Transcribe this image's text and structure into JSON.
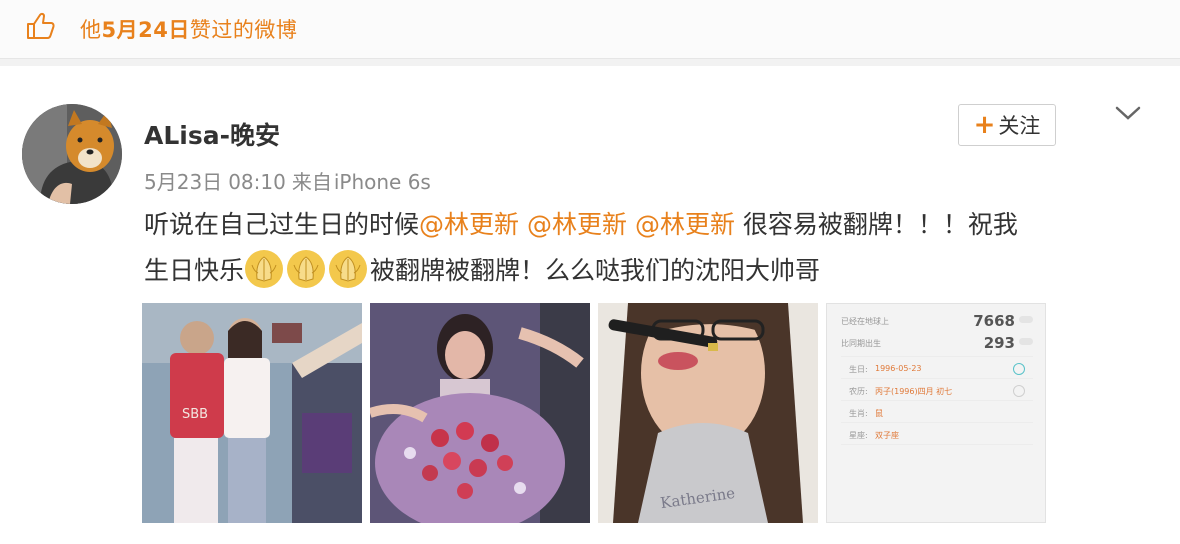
{
  "liked_bar": {
    "prefix": "他",
    "date": "5月24日",
    "suffix": "赞过的微博"
  },
  "post": {
    "username": "ALisa-晚安",
    "date": "5月23日",
    "time": "08:10",
    "source_prefix": "来自",
    "source": "iPhone 6s",
    "follow_label": "关注",
    "text_part1": "听说在自己过生日的时候",
    "mentions": [
      "@林更新",
      "@林更新",
      "@林更新"
    ],
    "text_part2": "很容易被翻牌！！！祝我",
    "text_part3": "生日快乐",
    "emoji_name": "pray-emoji",
    "text_part4": "被翻牌被翻牌！么么哒我们的沈阳大帅哥"
  },
  "photos": [
    {
      "name": "photo-two-girls"
    },
    {
      "name": "photo-girl-flowers"
    },
    {
      "name": "photo-selfie-pen"
    },
    {
      "name": "photo-stats-screenshot"
    }
  ],
  "stats_shot": {
    "row1_label": "已经在地球上",
    "row1_value": "7668",
    "row2_label": "比同期出生",
    "row2_value": "293",
    "fields": [
      {
        "label": "生日:",
        "value": "1996-05-23"
      },
      {
        "label": "农历:",
        "value": "丙子(1996)四月 初七"
      },
      {
        "label": "生肖:",
        "value": "鼠"
      },
      {
        "label": "星座:",
        "value": "双子座"
      }
    ]
  },
  "colors": {
    "accent": "#e8811c",
    "text": "#333333",
    "meta": "#8a8a8a"
  }
}
